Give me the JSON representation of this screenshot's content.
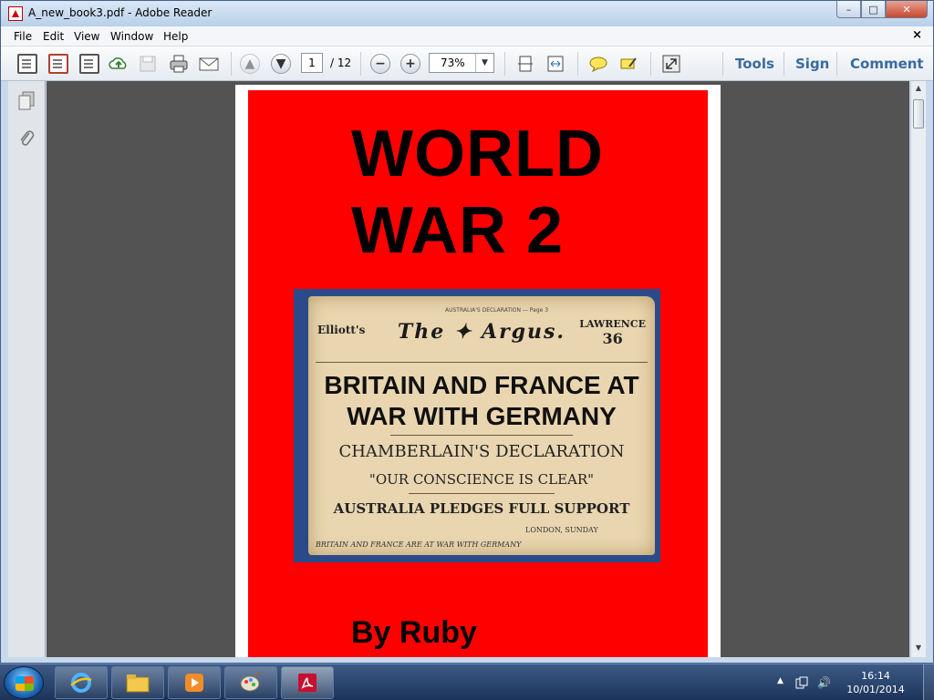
{
  "window": {
    "title": "A_new_book3.pdf - Adobe Reader",
    "min_glyph": "–",
    "max_glyph": "□",
    "close_glyph": "✕"
  },
  "menu": {
    "items": [
      "File",
      "Edit",
      "View",
      "Window",
      "Help"
    ],
    "close_glyph": "×"
  },
  "toolbar": {
    "page_current": "1",
    "page_total": "/ 12",
    "zoom": "73%",
    "zoom_arrow": "▼",
    "prev_glyph": "▲",
    "next_glyph": "▼",
    "zoom_out_glyph": "−",
    "zoom_in_glyph": "+",
    "tools_label": "Tools",
    "sign_label": "Sign",
    "comment_label": "Comment"
  },
  "document": {
    "heading_line1": "WORLD",
    "heading_line2": "WAR 2",
    "author": "By Ruby",
    "newspaper": {
      "topline": "AUSTRALIA'S DECLARATION — Page 3",
      "masthead_left": "Elliott's",
      "masthead": "The ✦ Argus.",
      "masthead_right_1": "LAWRENCE",
      "masthead_right_2": "36",
      "headline_1": "BRITAIN AND FRANCE AT",
      "headline_2": "WAR WITH GERMANY",
      "sub_1": "CHAMBERLAIN'S DECLARATION",
      "sub_2": "\"OUR CONSCIENCE IS CLEAR\"",
      "sub_3": "AUSTRALIA PLEDGES FULL SUPPORT",
      "dateline": "LONDON, SUNDAY",
      "footer": "BRITAIN AND FRANCE ARE AT WAR WITH GERMANY"
    }
  },
  "scrollbar": {
    "up_glyph": "▲",
    "down_glyph": "▼"
  },
  "taskbar": {
    "time": "16:14",
    "date": "10/01/2014",
    "tray_arrow": "▲",
    "tray_volume": "🔊"
  },
  "colors": {
    "page_background": "#ff0000",
    "link_blue": "#3a6aa0"
  }
}
